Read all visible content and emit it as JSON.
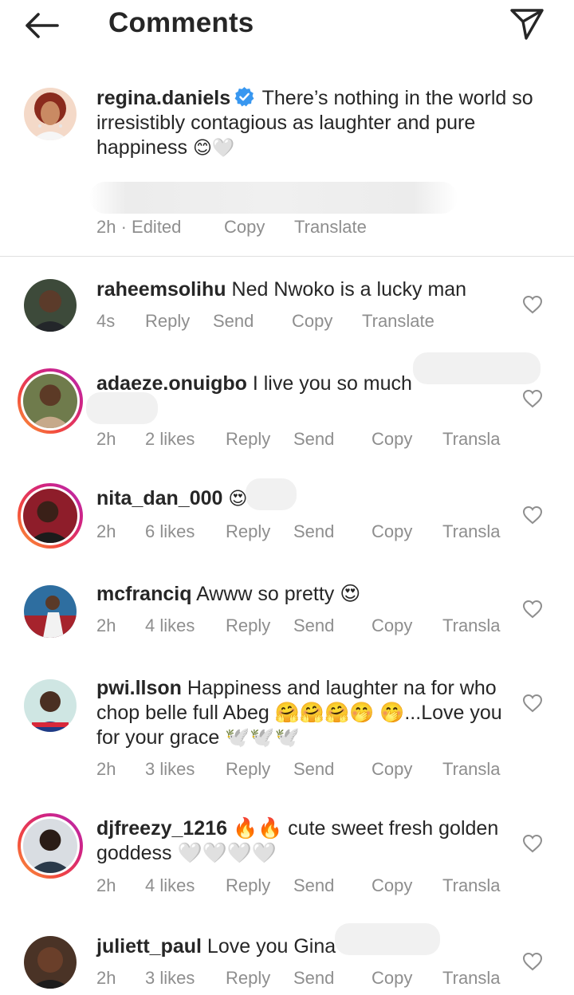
{
  "header": {
    "title": "Comments",
    "back_icon": "arrow-left-icon",
    "share_icon": "paper-plane-icon"
  },
  "caption": {
    "username": "regina.daniels",
    "text": "There’s nothing in the world so irresistibly contagious as laughter and pure happiness",
    "emojis": "😊🤍",
    "time": "2h · Edited",
    "copy": "Copy",
    "translate": "Translate"
  },
  "comments": [
    {
      "username": "raheemsolihu",
      "text": "Ned Nwoko is a lucky man",
      "time": "4s",
      "likes": "",
      "reply": "Reply",
      "send": "Send",
      "copy": "Copy",
      "translate": "Translate"
    },
    {
      "username": "adaeze.onuigbo",
      "text": "I live you so much",
      "time": "2h",
      "likes": "2 likes",
      "reply": "Reply",
      "send": "Send",
      "copy": "Copy",
      "translate": "Transla"
    },
    {
      "username": "nita_dan_000",
      "text": "😍",
      "time": "2h",
      "likes": "6 likes",
      "reply": "Reply",
      "send": "Send",
      "copy": "Copy",
      "translate": "Transla"
    },
    {
      "username": "mcfranciq",
      "text": "Awww so pretty 😍",
      "time": "2h",
      "likes": "4 likes",
      "reply": "Reply",
      "send": "Send",
      "copy": "Copy",
      "translate": "Transla"
    },
    {
      "username": "pwi.llson",
      "text": "Happiness and laughter na for who chop belle full Abeg 🤗🤗🤗🤭 🤭...Love you for your grace 🕊️🕊️🕊️",
      "time": "2h",
      "likes": "3 likes",
      "reply": "Reply",
      "send": "Send",
      "copy": "Copy",
      "translate": "Transla"
    },
    {
      "username": "djfreezy_1216",
      "text": "🔥🔥 cute sweet fresh golden goddess 🤍🤍🤍🤍",
      "time": "2h",
      "likes": "4 likes",
      "reply": "Reply",
      "send": "Send",
      "copy": "Copy",
      "translate": "Transla"
    },
    {
      "username": "juliett_paul",
      "text": "Love you Gina",
      "time": "2h",
      "likes": "3 likes",
      "reply": "Reply",
      "send": "Send",
      "copy": "Copy",
      "translate": "Transla"
    }
  ],
  "colors": {
    "text": "#262626",
    "meta": "#8e8e8e",
    "verified": "#3897f0",
    "story_ring": [
      "#f9a03a",
      "#f2473f",
      "#d3247e",
      "#b62bb2"
    ]
  }
}
